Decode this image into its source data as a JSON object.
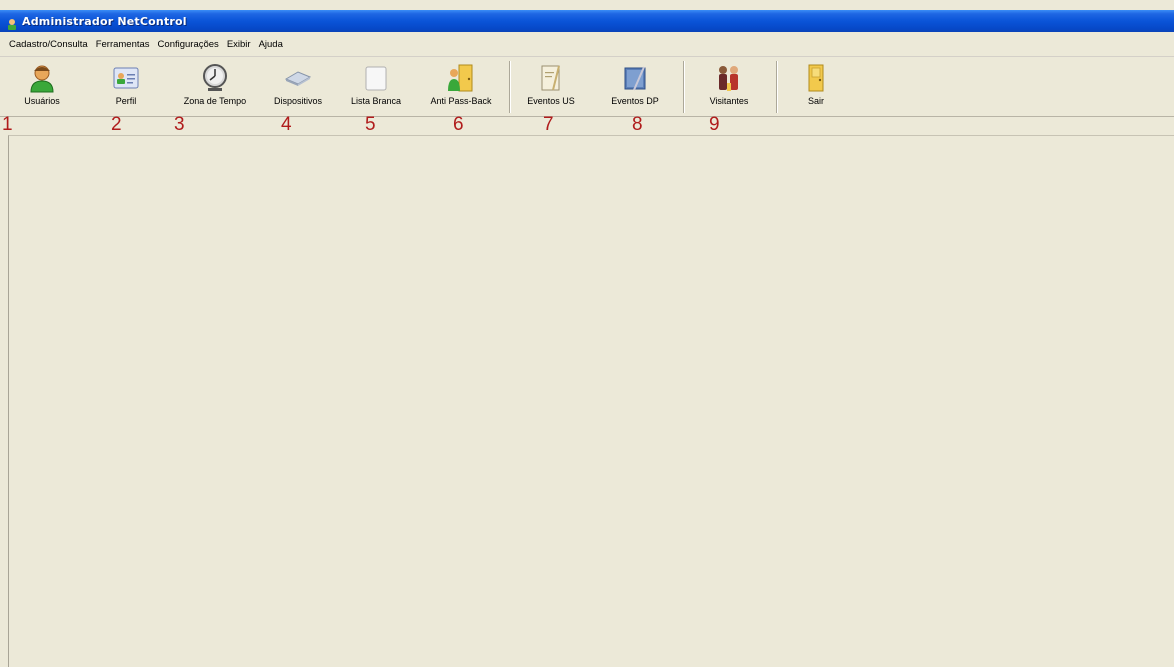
{
  "window": {
    "title": "Administrador NetControl"
  },
  "menu": [
    {
      "label": "Cadastro/Consulta"
    },
    {
      "label": "Ferramentas"
    },
    {
      "label": "Configurações"
    },
    {
      "label": "Exibir"
    },
    {
      "label": "Ajuda"
    }
  ],
  "toolbar": {
    "users_label": "Usuários",
    "profile_label": "Perfil",
    "timezone_label": "Zona de Tempo",
    "devices_label": "Dispositivos",
    "whitelist_label": "Lista Branca",
    "antipassback_label": "Anti Pass-Back",
    "events_us_label": "Eventos US",
    "events_dp_label": "Eventos DP",
    "visitors_label": "Visitantes",
    "exit_label": "Sair"
  },
  "annotations": [
    "1",
    "2",
    "3",
    "4",
    "5",
    "6",
    "7",
    "8",
    "9"
  ],
  "colors": {
    "titlebar": "#0a54d8",
    "background": "#ece9d8",
    "annotation": "#b01c1c"
  }
}
